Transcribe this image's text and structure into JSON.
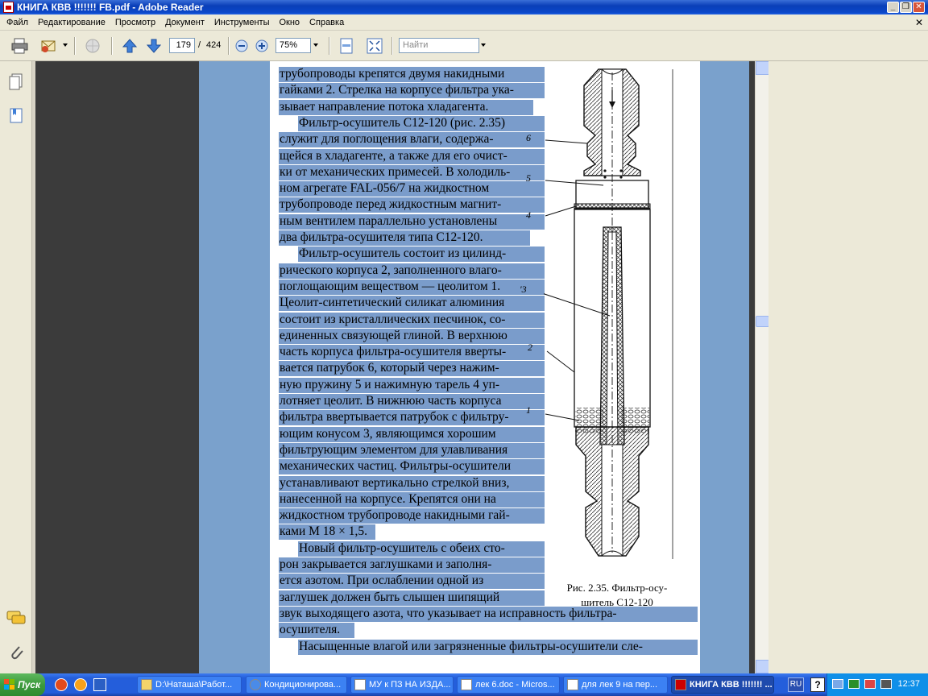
{
  "window": {
    "title": "КНИГА КВВ !!!!!!! FB.pdf - Adobe Reader",
    "minimize_glyph": "_",
    "maximize_glyph": "❐",
    "close_glyph": "✕"
  },
  "menu": {
    "items": [
      "Файл",
      "Редактирование",
      "Просмотр",
      "Документ",
      "Инструменты",
      "Окно",
      "Справка"
    ],
    "doc_close_glyph": "✕"
  },
  "toolbar": {
    "page_current": "179",
    "page_separator": "/",
    "page_total": "424",
    "zoom": "75%",
    "search_placeholder": "Найти"
  },
  "document": {
    "text_lines": [
      "трубопроводы крепятся двумя накидными",
      "гайками 2. Стрелка на корпусе фильтра ука-",
      "зывает направление потока хладагента.",
      "Фильтр-осушитель С12-120 (рис. 2.35)",
      "служит для поглощения влаги, содержа-",
      "щейся в хладагенте, а также для его очист-",
      "ки от механических примесей. В холодиль-",
      "ном агрегате FAL-056/7 на жидкостном",
      "трубопроводе перед жидкостным магнит-",
      "ным вентилем параллельно установлены",
      "два фильтра-осушителя типа С12-120.",
      "Фильтр-осушитель состоит из цилинд-",
      "рического корпуса 2, заполненного влаго-",
      "поглощающим веществом — цеолитом 1.",
      "Цеолит-синтетический силикат алюминия",
      "состоит из кристаллических песчинок, со-",
      "единенных связующей глиной. В верхнюю",
      "часть корпуса фильтра-осушителя вверты-",
      "вается патрубок 6, который через нажим-",
      "ную пружину 5 и нажимную тарель 4 уп-",
      "лотняет цеолит. В нижнюю часть корпуса",
      "фильтра ввертывается патрубок с фильтру-",
      "ющим конусом 3, являющимся хорошим",
      "фильтрующим элементом для улавливания",
      "механических частиц. Фильтры-осушители",
      "устанавливают вертикально стрелкой вниз,",
      "нанесенной на корпусе. Крепятся они на",
      "жидкостном трубопроводе накидными гай-",
      "ками М 18 × 1,5.",
      "Новый фильтр-осушитель с обеих сто-",
      "рон закрывается заглушками и заполня-",
      "ется азотом. При ослаблении одной из",
      "заглушек должен быть слышен шипящий",
      "звук выходящего азота, что указывает на исправность фильтра-",
      "осушителя.",
      "Насыщенные влагой или загрязненные фильтры-осушители сле-"
    ],
    "caption_line1": "Рис. 2.35. Фильтр-осу-",
    "caption_line2": "шитель С12-120",
    "figure_labels": [
      "6",
      "5",
      "4",
      "'3",
      "2",
      "1"
    ]
  },
  "taskbar": {
    "start_label": "Пуск",
    "tasks": [
      "D:\\Наташа\\Работ...",
      "Кондиционирова...",
      "МУ к ПЗ НА ИЗДА...",
      "лек 6.doc - Micros...",
      "для лек 9 на пер...",
      "КНИГА КВВ !!!!!!! ..."
    ],
    "language": "RU",
    "clock": "12:37"
  },
  "colors": {
    "selection": "#7a9ccb",
    "page_margin": "#7aa1cc",
    "doc_background": "#3b3b3b"
  }
}
